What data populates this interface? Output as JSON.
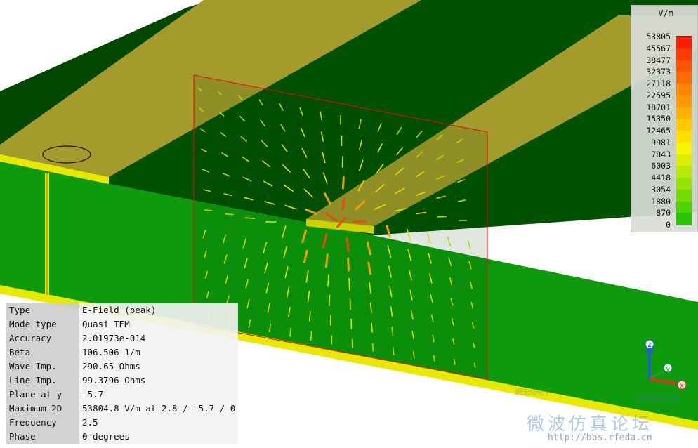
{
  "info_panel": {
    "rows": [
      {
        "key": "Type",
        "value": "E-Field (peak)"
      },
      {
        "key": "Mode type",
        "value": "Quasi TEM"
      },
      {
        "key": "Accuracy",
        "value": "2.01973e-014"
      },
      {
        "key": "Beta",
        "value": "106.506 1/m"
      },
      {
        "key": "Wave Imp.",
        "value": "290.65 Ohms"
      },
      {
        "key": "Line Imp.",
        "value": "99.3796 Ohms"
      },
      {
        "key": "Plane at y",
        "value": "-5.7"
      },
      {
        "key": "Maximum-2D",
        "value": "53804.8 V/m at 2.8 / -5.7 / 0"
      },
      {
        "key": "Frequency",
        "value": "2.5"
      },
      {
        "key": "Phase",
        "value": "0 degrees"
      }
    ]
  },
  "legend": {
    "unit": "V/m",
    "ticks": [
      "53805",
      "45567",
      "38477",
      "32373",
      "27118",
      "22595",
      "18701",
      "15350",
      "12465",
      "9981",
      "7843",
      "6003",
      "4418",
      "3054",
      "1880",
      "870",
      "0"
    ],
    "colors": [
      "#ff1e00",
      "#ff3c00",
      "#ff5500",
      "#ff6e00",
      "#ff8400",
      "#ff9a00",
      "#ffb000",
      "#ffc800",
      "#ffe000",
      "#f6f400",
      "#d8f000",
      "#b8ea00",
      "#96e200",
      "#74da00",
      "#4ed200",
      "#28c800"
    ]
  },
  "axes": {
    "z_label": "z",
    "y_label": "y",
    "x_label": "x"
  },
  "watermark": {
    "tag": "网无线电子",
    "brand": "RFEDA.CN",
    "chinese": "微波仿真论坛",
    "url": "http://bbs.rfeda.cn"
  },
  "scene_colors": {
    "substrate_top": "#004f00",
    "substrate_front": "#0b9a0b",
    "trace": "#a19a2a",
    "edge": "#e6e600",
    "port_outline": "#ff0000"
  }
}
